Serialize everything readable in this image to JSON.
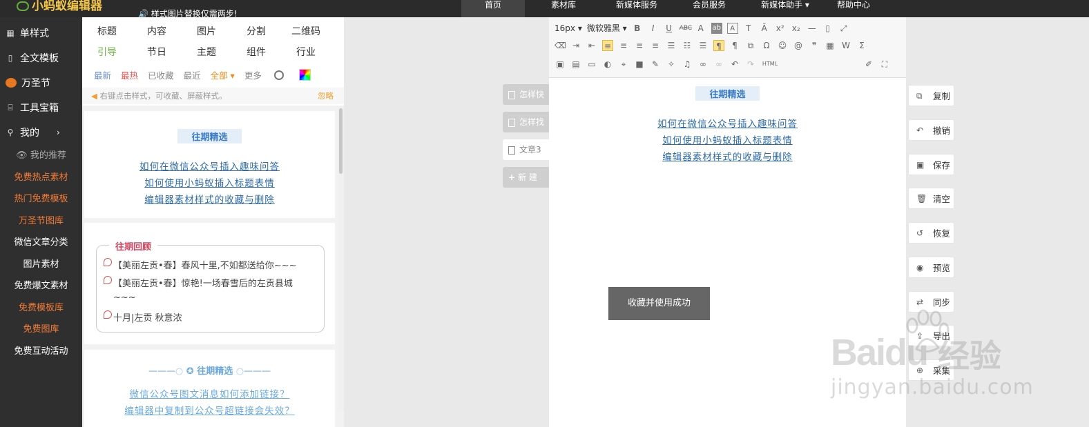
{
  "topbar": {
    "logo": "小蚂蚁编辑器",
    "notice": "样式图片替换仅需两步!",
    "nav": [
      "首页",
      "素材库",
      "新媒体服务",
      "会员服务",
      "新媒体助手 ▾",
      "帮助中心"
    ],
    "active_index": 0
  },
  "sidebar": {
    "main": [
      {
        "label": "单样式",
        "icon": "grid-icon"
      },
      {
        "label": "全文模板",
        "icon": "template-icon"
      },
      {
        "label": "万圣节",
        "icon": "pumpkin-icon"
      },
      {
        "label": "工具宝箱",
        "icon": "toolbox-icon"
      },
      {
        "label": "我的",
        "icon": "user-icon"
      }
    ],
    "my_chevron": "›",
    "sub": [
      {
        "label": "我的推荐",
        "tone": "gray"
      },
      {
        "label": "免费热点素材",
        "tone": "orange"
      },
      {
        "label": "热门免费模板",
        "tone": "orange"
      },
      {
        "label": "万圣节图库",
        "tone": "orange"
      },
      {
        "label": "微信文章分类",
        "tone": "white"
      },
      {
        "label": "图片素材",
        "tone": "white"
      },
      {
        "label": "免费爆文素材",
        "tone": "white"
      },
      {
        "label": "免费模板库",
        "tone": "orange"
      },
      {
        "label": "免费图库",
        "tone": "orange"
      },
      {
        "label": "免费互动活动",
        "tone": "white"
      }
    ]
  },
  "panel": {
    "categories_row1": [
      "标题",
      "内容",
      "图片",
      "分割",
      "二维码"
    ],
    "categories_row2": [
      "引导",
      "节日",
      "主题",
      "组件",
      "行业"
    ],
    "filters": [
      "最新",
      "最热",
      "已收藏",
      "最近",
      "全部 ▾",
      "更多"
    ],
    "hint": "右键点击样式，可收藏、屏蔽样式。",
    "ignore": "忽略",
    "card1": {
      "title": "往期精选",
      "links": [
        "如何在微信公众号插入趣味问答",
        "如何使用小蚂蚁插入标题表情",
        "编辑器素材样式的收藏与删除"
      ]
    },
    "card2": {
      "title": "往期回顾",
      "items": [
        "【美丽左贡•春】春风十里,不如都送给你~~~",
        "【美丽左贡•春】惊艳!一场春雪后的左贡县城",
        "~~~",
        "十月|左贡 秋意浓"
      ]
    },
    "card3": {
      "title": "往期精选",
      "links": [
        "微信公众号图文消息如何添加链接？",
        "编辑器中复制到公众号超链接会失效？"
      ]
    }
  },
  "doc_tabs": [
    "怎样快",
    "怎样找",
    "文章3",
    "新 建"
  ],
  "editor": {
    "font_size": "16px",
    "font_family": "微软雅黑",
    "html_label": "HTML",
    "content_title": "往期精选",
    "content_links": [
      "如何在微信公众号插入趣味问答",
      "如何使用小蚂蚁插入标题表情",
      "编辑器素材样式的收藏与删除"
    ]
  },
  "toast": "收藏并使用成功",
  "right_actions": [
    {
      "label": "复制",
      "icon": "copy-icon",
      "glyph": "⧉"
    },
    {
      "label": "撤销",
      "icon": "undo-icon",
      "glyph": "↶"
    },
    {
      "label": "保存",
      "icon": "save-icon",
      "glyph": "▣"
    },
    {
      "label": "清空",
      "icon": "trash-icon",
      "glyph": "🗑"
    },
    {
      "label": "恢复",
      "icon": "restore-icon",
      "glyph": "↺"
    },
    {
      "label": "预览",
      "icon": "eye-icon",
      "glyph": "◉"
    },
    {
      "label": "同步",
      "icon": "sync-icon",
      "glyph": "⇄"
    },
    {
      "label": "导出",
      "icon": "export-icon",
      "glyph": "⇪"
    },
    {
      "label": "采集",
      "icon": "collect-icon",
      "glyph": "⊕"
    }
  ],
  "watermark": {
    "brand": "Baidu",
    "cn": "经验",
    "url": "jingyan.baidu.com"
  },
  "colors": {
    "accent_green": "#6cbb45",
    "hot_red": "#e9534f",
    "orange": "#f37b36",
    "link_blue": "#2e6aa7"
  }
}
